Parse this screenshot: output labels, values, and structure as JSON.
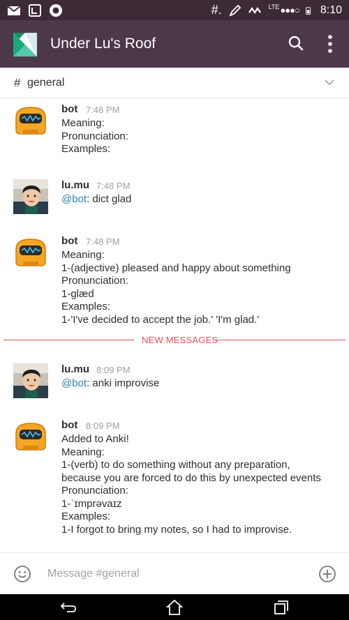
{
  "status_bar": {
    "time": "8:10",
    "network": "LTE",
    "icons": [
      "gmail-icon",
      "phone-icon",
      "notification-circle-icon",
      "hash-icon",
      "pen-icon",
      "wave-icon",
      "signal-dots-icon",
      "battery-icon"
    ]
  },
  "header": {
    "title": "Under Lu's Roof",
    "colors": {
      "status_bar": "#3c2a37",
      "app_bar": "#4d3849"
    }
  },
  "channel": {
    "hash": "#",
    "name": "general"
  },
  "messages": [
    {
      "author": "bot",
      "time": "7:48 PM",
      "avatar": "robot-avatar-icon",
      "lines": [
        "Meaning:",
        "Pronunciation:",
        "Examples:"
      ]
    },
    {
      "author": "lu.mu",
      "time": "7:48 PM",
      "avatar": "user-photo-avatar",
      "mention": "@bot",
      "text": ": dict glad"
    },
    {
      "author": "bot",
      "time": "7:48 PM",
      "avatar": "robot-avatar-icon",
      "lines": [
        "Meaning:",
        "1-(adjective) pleased and happy about something",
        "Pronunciation:",
        "1-glæd",
        "Examples:",
        "1-'I've decided to accept the job.' 'I'm glad.'"
      ]
    },
    {
      "author": "lu.mu",
      "time": "8:09 PM",
      "avatar": "user-photo-avatar",
      "mention": "@bot",
      "text": ": anki improvise"
    },
    {
      "author": "bot",
      "time": "8:09 PM",
      "avatar": "robot-avatar-icon",
      "lines": [
        "Added to Anki!",
        "Meaning:",
        "1-(verb) to do something without any preparation,",
        "because you are forced to do this by unexpected events",
        "Pronunciation:",
        "1-ˈɪmprəvaɪz",
        "Examples:",
        "1-I forgot to bring my notes, so I had to improvise."
      ]
    }
  ],
  "divider": {
    "label": "NEW MESSAGES",
    "color": "#eb4d5c"
  },
  "composer": {
    "placeholder": "Message #general"
  },
  "nav_bar": {
    "icons": [
      "back-icon",
      "home-icon",
      "recents-icon"
    ]
  }
}
